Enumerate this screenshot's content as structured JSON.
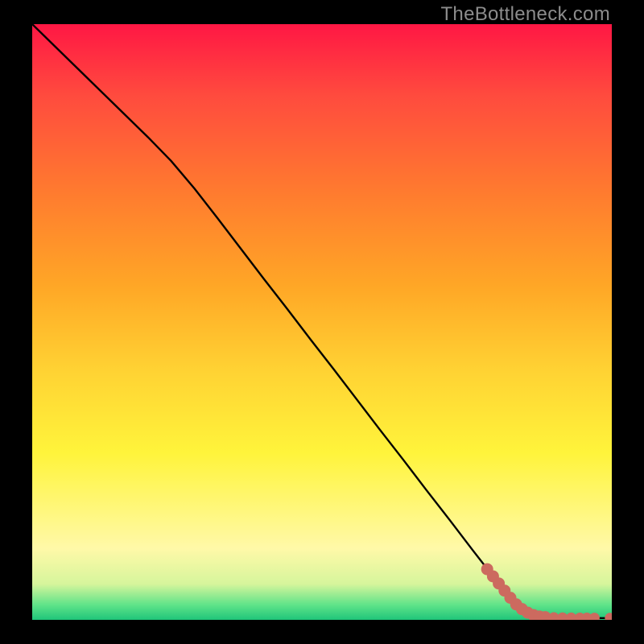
{
  "watermark": "TheBottleneck.com",
  "colors": {
    "black": "#000000",
    "gray": "#8c8c8c",
    "gradient": [
      "#ff1744",
      "#ff4b3e",
      "#ff7a2f",
      "#ffa726",
      "#ffd233",
      "#fff43b",
      "#fff9a8",
      "#d6f59c",
      "#5fe389",
      "#1fc57a"
    ],
    "lineStroke": "#000000",
    "point": "#cc6a5f"
  },
  "chart_data": {
    "type": "line",
    "title": "",
    "xlabel": "",
    "ylabel": "",
    "xlim": [
      0,
      100
    ],
    "ylim": [
      0,
      100
    ],
    "series": [
      {
        "name": "curve",
        "x": [
          0,
          4,
          8,
          12,
          16,
          20,
          24,
          28,
          32,
          36,
          40,
          44,
          48,
          52,
          56,
          60,
          64,
          68,
          72,
          76,
          80,
          84,
          88,
          90,
          92,
          94,
          96,
          98,
          100
        ],
        "y": [
          100,
          96.2,
          92.4,
          88.6,
          84.8,
          81.0,
          77.0,
          72.4,
          67.4,
          62.3,
          57.2,
          52.2,
          47.1,
          42.1,
          37.0,
          31.9,
          26.9,
          21.8,
          16.8,
          11.7,
          6.7,
          2.4,
          0.6,
          0.4,
          0.35,
          0.32,
          0.3,
          0.3,
          0.3
        ]
      }
    ],
    "points": [
      {
        "x": 78.5,
        "y": 8.5
      },
      {
        "x": 79.5,
        "y": 7.3
      },
      {
        "x": 80.5,
        "y": 6.1
      },
      {
        "x": 81.5,
        "y": 4.9
      },
      {
        "x": 82.5,
        "y": 3.7
      },
      {
        "x": 83.5,
        "y": 2.6
      },
      {
        "x": 84.5,
        "y": 1.8
      },
      {
        "x": 85.5,
        "y": 1.2
      },
      {
        "x": 86.5,
        "y": 0.8
      },
      {
        "x": 87.5,
        "y": 0.55
      },
      {
        "x": 88.5,
        "y": 0.45
      },
      {
        "x": 90.0,
        "y": 0.4
      },
      {
        "x": 91.5,
        "y": 0.38
      },
      {
        "x": 93.0,
        "y": 0.36
      },
      {
        "x": 94.5,
        "y": 0.34
      },
      {
        "x": 95.7,
        "y": 0.33
      },
      {
        "x": 97.0,
        "y": 0.32
      },
      {
        "x": 99.7,
        "y": 0.3
      }
    ]
  }
}
